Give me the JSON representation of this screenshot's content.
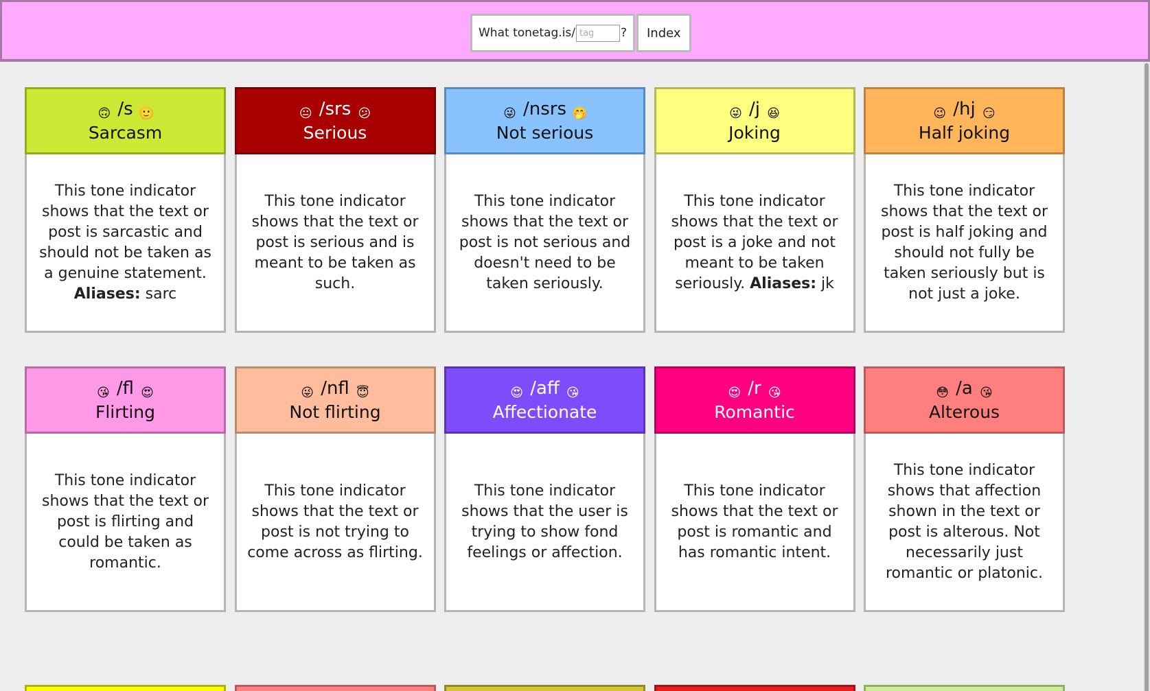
{
  "header": {
    "prefix": "What tonetag.is/",
    "input_placeholder": "tag",
    "suffix": "?",
    "index_label": "Index"
  },
  "cards": [
    {
      "tag": "/s",
      "title": "Sarcasm",
      "desc": "This tone indicator shows that the text or post is sarcastic and should not be taken as a genuine statement.",
      "alias_label": "Aliases:",
      "alias": "sarc",
      "head_color": "#cde835",
      "border_color": "#8fae1e",
      "text_color": "#111111",
      "emoji_left": "upside-down-face",
      "emoji_right": "slightly-smiling-face"
    },
    {
      "tag": "/srs",
      "title": "Serious",
      "desc": "This tone indicator shows that the text or post is serious and is meant to be taken as such.",
      "alias_label": "",
      "alias": "",
      "head_color": "#a80000",
      "border_color": "#7a0000",
      "text_color": "#ffffff",
      "emoji_left": "neutral-face",
      "emoji_right": "confused-face"
    },
    {
      "tag": "/nsrs",
      "title": "Not serious",
      "desc": "This tone indicator shows that the text or post is not serious and doesn't need to be taken seriously.",
      "alias_label": "",
      "alias": "",
      "head_color": "#88c3ff",
      "border_color": "#5a88c0",
      "text_color": "#111111",
      "emoji_left": "winking-tongue-face",
      "emoji_right": "hand-over-mouth-face"
    },
    {
      "tag": "/j",
      "title": "Joking",
      "desc": "This tone indicator shows that the text or post is a joke and not meant to be taken seriously.",
      "alias_label": "Aliases:",
      "alias": "jk",
      "head_color": "#ffff7f",
      "border_color": "#b5b55a",
      "text_color": "#111111",
      "emoji_left": "winking-tongue-face",
      "emoji_right": "grinning-squinting-face"
    },
    {
      "tag": "/hj",
      "title": "Half joking",
      "desc": "This tone indicator shows that the text or post is half joking and should not fully be taken seriously but is not just a joke.",
      "alias_label": "",
      "alias": "",
      "head_color": "#ffb55a",
      "border_color": "#c08040",
      "text_color": "#111111",
      "emoji_left": "winking-face",
      "emoji_right": "smirking-face"
    },
    {
      "tag": "/fl",
      "title": "Flirting",
      "desc": "This tone indicator shows that the text or post is flirting and could be taken as romantic.",
      "alias_label": "",
      "alias": "",
      "head_color": "#ff99e8",
      "border_color": "#b86aa6",
      "text_color": "#111111",
      "emoji_left": "face-blowing-kiss",
      "emoji_right": "heart-eyes-face"
    },
    {
      "tag": "/nfl",
      "title": "Not flirting",
      "desc": "This tone indicator shows that the text or post is not trying to come across as flirting.",
      "alias_label": "",
      "alias": "",
      "head_color": "#ffbd9d",
      "border_color": "#b88a6e",
      "text_color": "#111111",
      "emoji_left": "winking-tongue-face",
      "emoji_right": "smiling-face-with-halo"
    },
    {
      "tag": "/aff",
      "title": "Affectionate",
      "desc": "This tone indicator shows that the user is trying to show fond feelings or affection.",
      "alias_label": "",
      "alias": "",
      "head_color": "#7f4cfb",
      "border_color": "#5a34b5",
      "text_color": "#ffffff",
      "emoji_left": "heart-eyes-face",
      "emoji_right": "face-blowing-kiss"
    },
    {
      "tag": "/r",
      "title": "Romantic",
      "desc": "This tone indicator shows that the text or post is romantic and has romantic intent.",
      "alias_label": "",
      "alias": "",
      "head_color": "#ff0080",
      "border_color": "#b3005a",
      "text_color": "#ffffff",
      "emoji_left": "heart-eyes-face",
      "emoji_right": "face-blowing-kiss"
    },
    {
      "tag": "/a",
      "title": "Alterous",
      "desc": "This tone indicator shows that affection shown in the text or post is alterous. Not necessarily just romantic or platonic.",
      "alias_label": "",
      "alias": "",
      "head_color": "#ff7f7f",
      "border_color": "#b85a5a",
      "text_color": "#111111",
      "emoji_left": "flushed-face",
      "emoji_right": "face-blowing-kiss"
    }
  ],
  "stubs": [
    {
      "head_color": "#ffff00",
      "border_color": "#b3b300"
    },
    {
      "head_color": "#ff7f7f",
      "border_color": "#b85a5a"
    },
    {
      "head_color": "#d8c43a",
      "border_color": "#968826"
    },
    {
      "head_color": "#e62020",
      "border_color": "#a51515"
    },
    {
      "head_color": "#ccf09a",
      "border_color": "#92b06a"
    }
  ]
}
